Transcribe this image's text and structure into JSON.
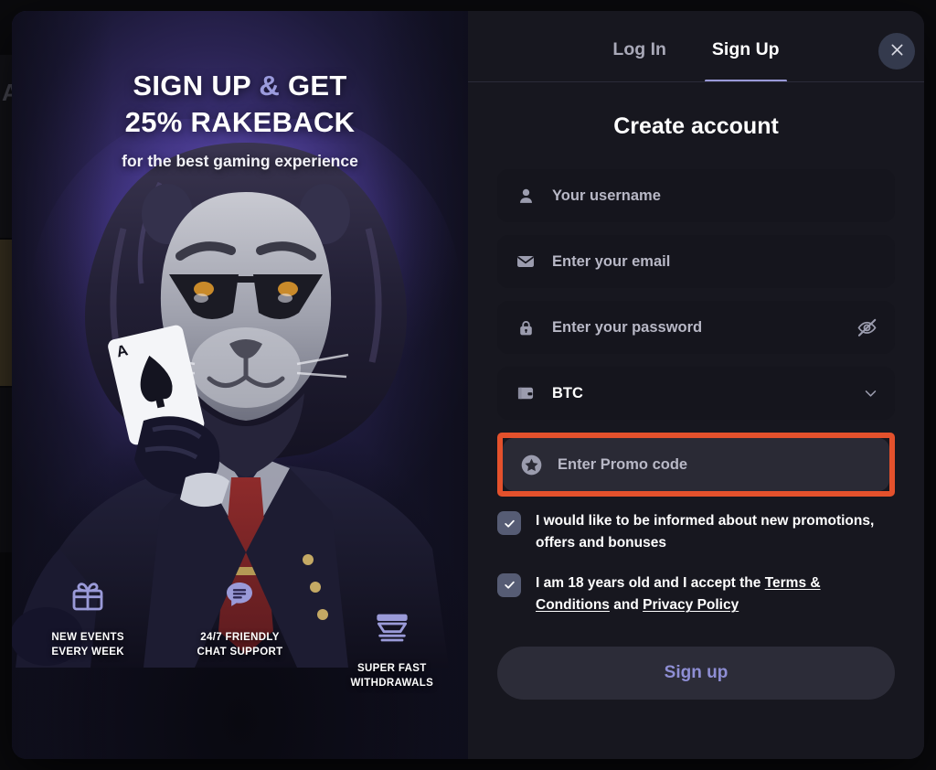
{
  "backdrop": {
    "ghost_letter": "A"
  },
  "promo": {
    "headline_line1_a": "SIGN UP ",
    "headline_amp": "&",
    "headline_line1_b": " GET",
    "headline_line2": "25% RAKEBACK",
    "subtitle": "for the best gaming experience",
    "features": [
      {
        "icon": "gift-icon",
        "label_line1": "NEW EVENTS",
        "label_line2": "EVERY WEEK"
      },
      {
        "icon": "chat-bubble-icon",
        "label_line1": "24/7 FRIENDLY",
        "label_line2": "CHAT SUPPORT"
      },
      {
        "icon": "withdrawal-icon",
        "label_line1": "SUPER FAST",
        "label_line2": "WITHDRAWALS"
      }
    ]
  },
  "header": {
    "tab_login": "Log In",
    "tab_signup": "Sign Up",
    "active_tab": "Sign Up",
    "close_icon": "close-icon"
  },
  "form": {
    "title": "Create account",
    "username": {
      "icon": "user-icon",
      "placeholder": "Your username",
      "value": ""
    },
    "email": {
      "icon": "envelope-icon",
      "placeholder": "Enter your email",
      "value": ""
    },
    "password": {
      "icon": "lock-icon",
      "placeholder": "Enter your password",
      "value": "",
      "toggle_icon": "eye-off-icon"
    },
    "currency": {
      "icon": "wallet-icon",
      "value": "BTC",
      "chevron_icon": "chevron-down-icon"
    },
    "promo": {
      "icon": "star-badge-icon",
      "placeholder": "Enter Promo code",
      "value": ""
    },
    "consent_newsletter": {
      "checked": true,
      "text": "I would like to be informed about new promotions, offers and bonuses"
    },
    "consent_terms": {
      "checked": true,
      "prefix": "I am 18 years old and I accept the ",
      "link_terms": "Terms & Conditions",
      "middle": " and ",
      "link_privacy": "Privacy Policy"
    },
    "submit_label": "Sign up"
  },
  "colors": {
    "accent_purple": "#9a9ad8",
    "highlight_red": "#e4512c",
    "panel_bg": "#17171f",
    "field_bg": "#15151d",
    "field_bg_focus": "#2a2a35",
    "checkbox_bg": "#565c74"
  }
}
